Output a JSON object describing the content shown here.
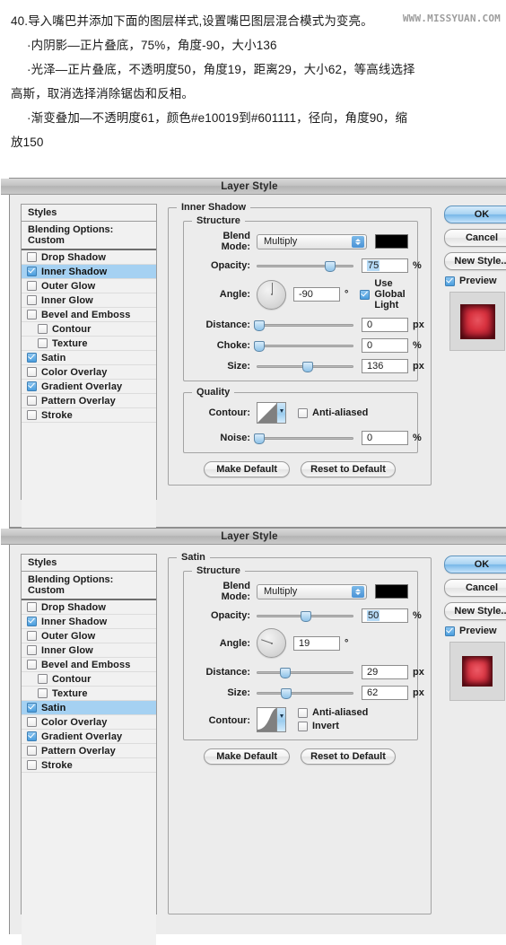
{
  "intro": {
    "line1": "40.导入嘴巴并添加下面的图层样式,设置嘴巴图层混合模式为变亮。",
    "line2": "·内阴影—正片叠底，75%，角度-90，大小136",
    "line3": "·光泽—正片叠底，不透明度50，角度19，距离29，大小62，等高线选择",
    "line4": "高斯，取消选择消除锯齿和反相。",
    "line5": "·渐变叠加—不透明度61，颜色#e10019到#601111，径向，角度90，缩",
    "line6": "放150",
    "watermark": "WWW.MISSYUAN.COM"
  },
  "dialog_title": "Layer Style",
  "styles_panel": {
    "header": "Styles",
    "blending_options": "Blending Options: Custom",
    "items": [
      {
        "label": "Drop Shadow",
        "checked": false,
        "sub": false
      },
      {
        "label": "Inner Shadow",
        "checked": true,
        "sub": false
      },
      {
        "label": "Outer Glow",
        "checked": false,
        "sub": false
      },
      {
        "label": "Inner Glow",
        "checked": false,
        "sub": false
      },
      {
        "label": "Bevel and Emboss",
        "checked": false,
        "sub": false
      },
      {
        "label": "Contour",
        "checked": false,
        "sub": true
      },
      {
        "label": "Texture",
        "checked": false,
        "sub": true
      },
      {
        "label": "Satin",
        "checked": true,
        "sub": false
      },
      {
        "label": "Color Overlay",
        "checked": false,
        "sub": false
      },
      {
        "label": "Gradient Overlay",
        "checked": true,
        "sub": false
      },
      {
        "label": "Pattern Overlay",
        "checked": false,
        "sub": false
      },
      {
        "label": "Stroke",
        "checked": false,
        "sub": false
      }
    ]
  },
  "buttons": {
    "ok": "OK",
    "cancel": "Cancel",
    "new_style": "New Style...",
    "preview": "Preview",
    "make_default": "Make Default",
    "reset_to_default": "Reset to Default"
  },
  "dialog1": {
    "selected_style": "Inner Shadow",
    "group_title": "Inner Shadow",
    "structure_title": "Structure",
    "quality_title": "Quality",
    "labels": {
      "blend_mode": "Blend Mode:",
      "opacity": "Opacity:",
      "angle": "Angle:",
      "use_global_light": "Use Global Light",
      "distance": "Distance:",
      "choke": "Choke:",
      "size": "Size:",
      "contour": "Contour:",
      "anti_aliased": "Anti-aliased",
      "noise": "Noise:"
    },
    "values": {
      "blend_mode": "Multiply",
      "blend_color": "#000000",
      "opacity": "75",
      "opacity_unit": "%",
      "angle": "-90",
      "angle_unit": "°",
      "use_global_light_checked": true,
      "distance": "0",
      "distance_unit": "px",
      "choke": "0",
      "choke_unit": "%",
      "size": "136",
      "size_unit": "px",
      "anti_aliased_checked": false,
      "noise": "0",
      "noise_unit": "%"
    },
    "preview_checked": true
  },
  "dialog2": {
    "selected_style": "Satin",
    "group_title": "Satin",
    "structure_title": "Structure",
    "labels": {
      "blend_mode": "Blend Mode:",
      "opacity": "Opacity:",
      "angle": "Angle:",
      "distance": "Distance:",
      "size": "Size:",
      "contour": "Contour:",
      "anti_aliased": "Anti-aliased",
      "invert": "Invert"
    },
    "values": {
      "blend_mode": "Multiply",
      "blend_color": "#000000",
      "opacity": "50",
      "opacity_unit": "%",
      "angle": "19",
      "angle_unit": "°",
      "distance": "29",
      "distance_unit": "px",
      "size": "62",
      "size_unit": "px",
      "anti_aliased_checked": false,
      "invert_checked": false
    },
    "preview_checked": true
  }
}
